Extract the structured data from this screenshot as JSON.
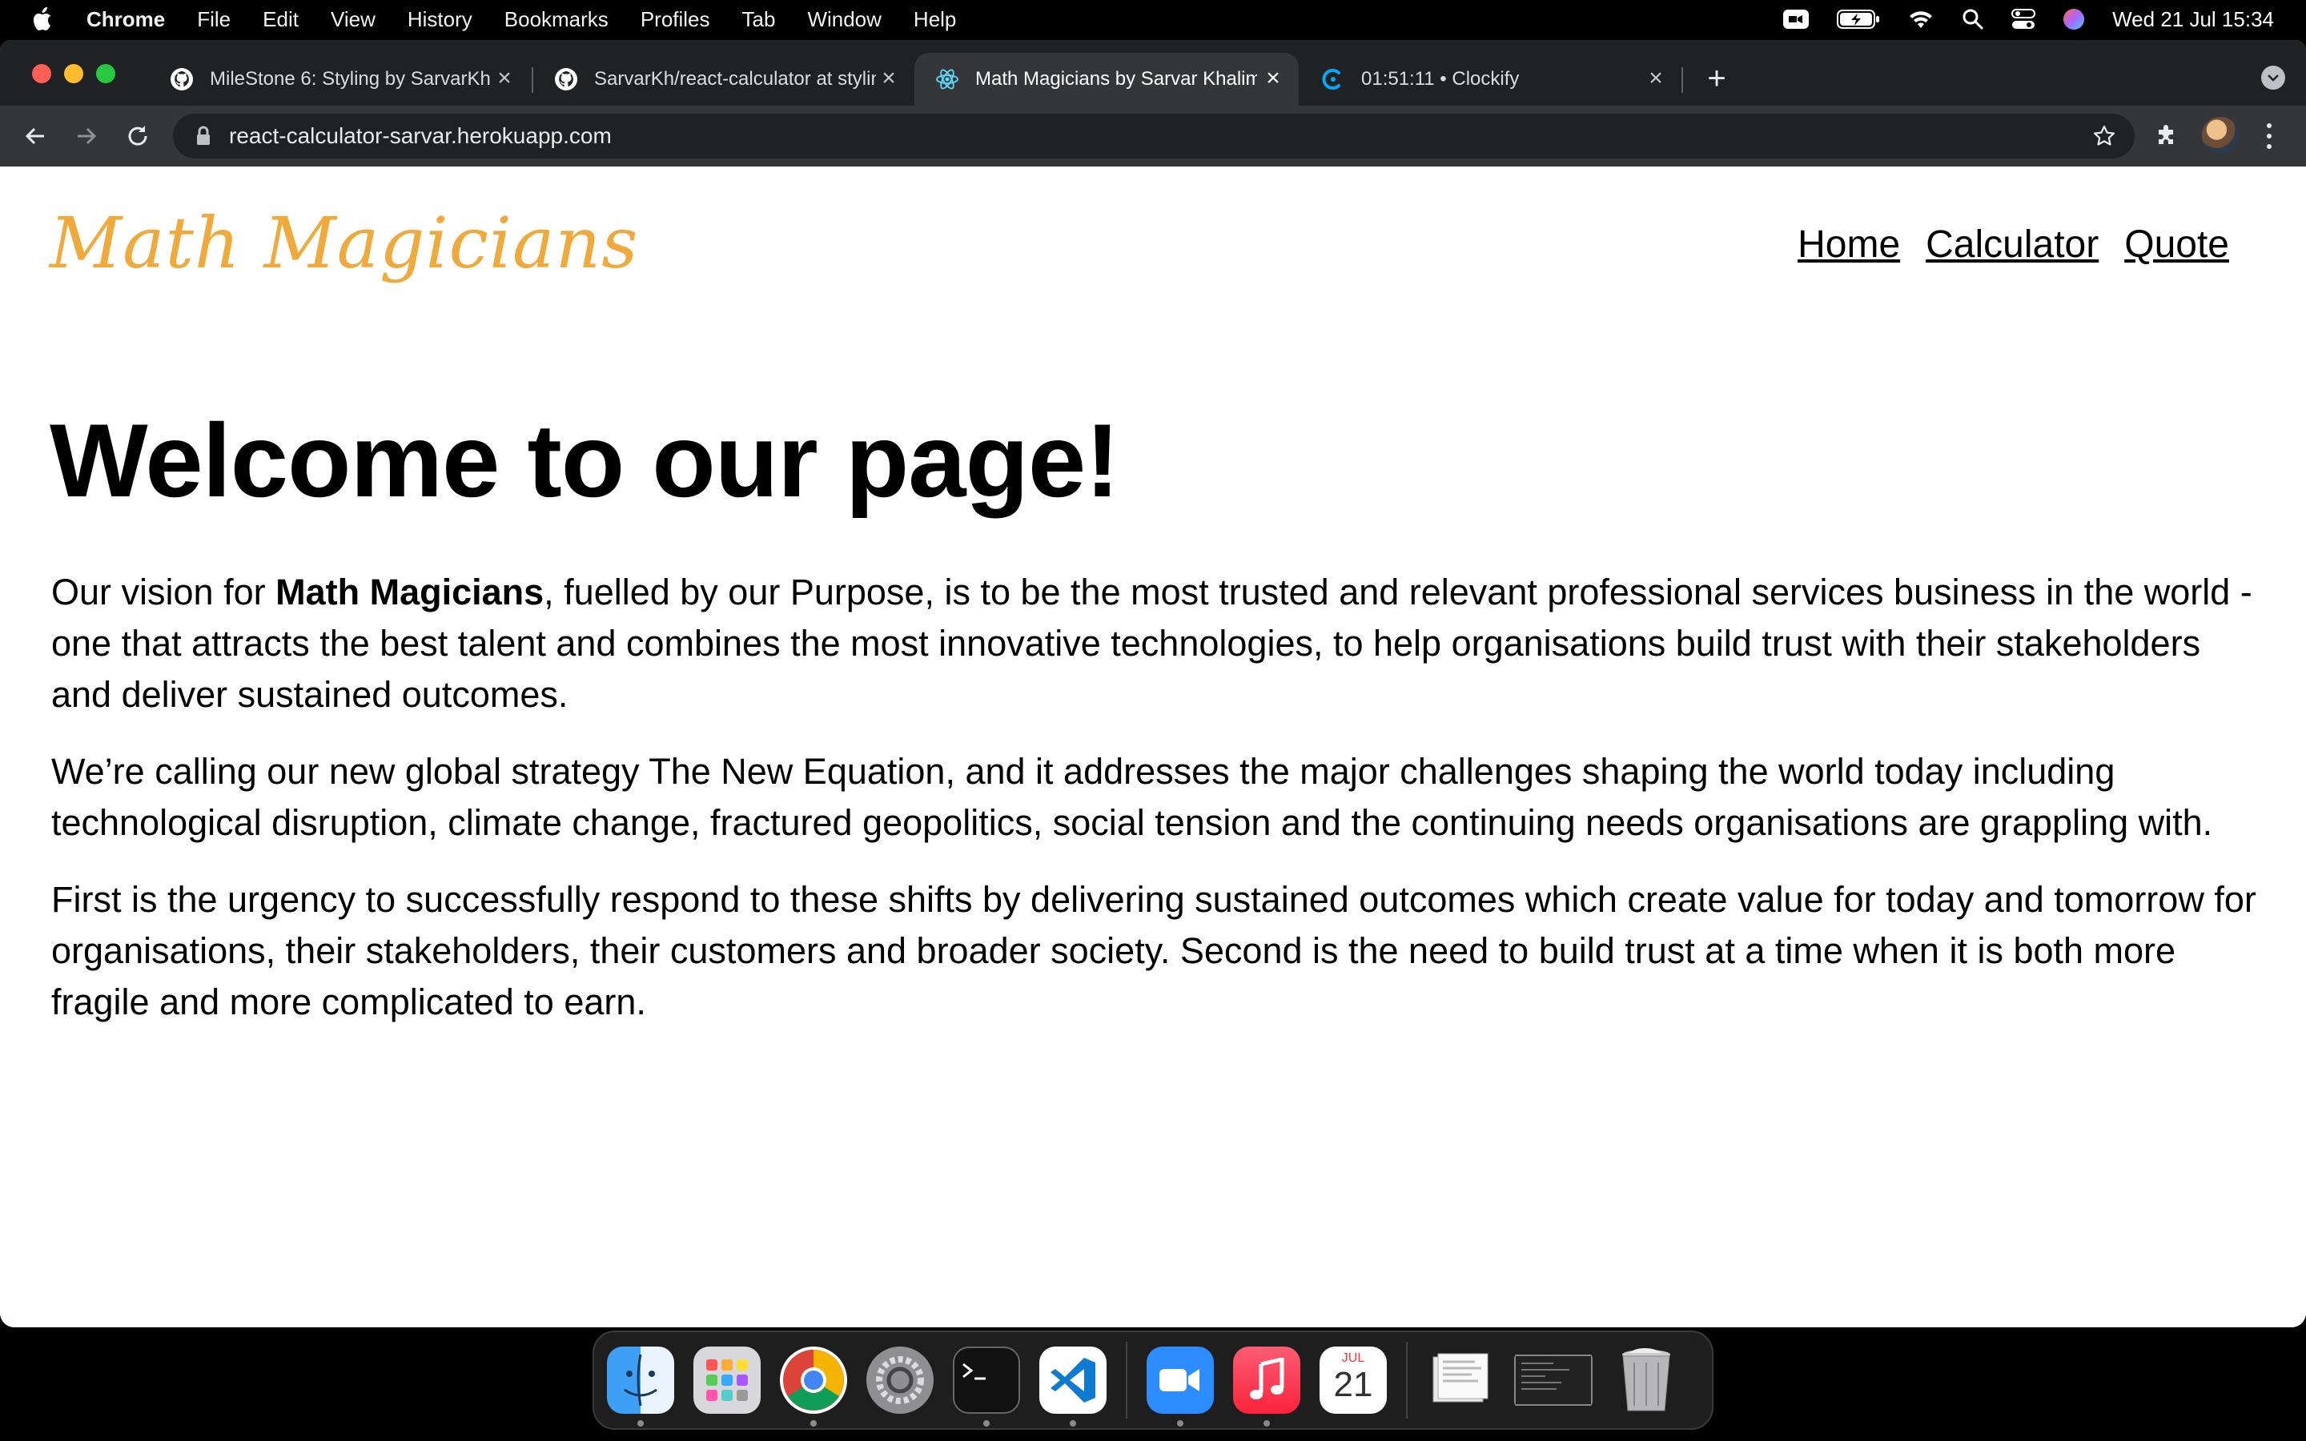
{
  "menubar": {
    "app_name": "Chrome",
    "items": [
      "File",
      "Edit",
      "View",
      "History",
      "Bookmarks",
      "Profiles",
      "Tab",
      "Window",
      "Help"
    ],
    "clock": "Wed 21 Jul  15:34"
  },
  "tabs": [
    {
      "title": "MileStone 6: Styling by SarvarKh",
      "icon": "github-icon"
    },
    {
      "title": "SarvarKh/react-calculator at styling",
      "icon": "github-icon"
    },
    {
      "title": "Math Magicians by Sarvar Khalimov",
      "icon": "react-icon",
      "active": true
    },
    {
      "title": "01:51:11 • Clockify",
      "icon": "clockify-icon"
    }
  ],
  "toolbar": {
    "url": "react-calculator-sarvar.herokuapp.com"
  },
  "page": {
    "logo": "Math Magicians",
    "nav": [
      "Home",
      "Calculator",
      "Quote"
    ],
    "heading": "Welcome to our page!",
    "p1_before": "Our vision for ",
    "p1_bold": "Math Magicians",
    "p1_after": ", fuelled by our Purpose, is to be the most trusted and relevant professional services business in the world - one that attracts the best talent and combines the most innovative technologies, to help organisations build trust with their stakeholders and deliver sustained outcomes.",
    "p2": "We’re calling our new global strategy The New Equation, and it addresses the major challenges shaping the world today including technological disruption, climate change, fractured geopolitics, social tension and the continuing needs organisations are grappling with.",
    "p3": "First is the urgency to successfully respond to these shifts by delivering sustained outcomes which create value for today and tomorrow for organisations, their stakeholders, their customers and broader society. Second is the need to build trust at a time when it is both more fragile and more complicated to earn."
  },
  "dock": {
    "calendar_month": "JUL",
    "calendar_day": "21"
  },
  "colors": {
    "logo": "#f0a93a",
    "tabstrip": "#202124",
    "toolbar": "#35363a"
  }
}
